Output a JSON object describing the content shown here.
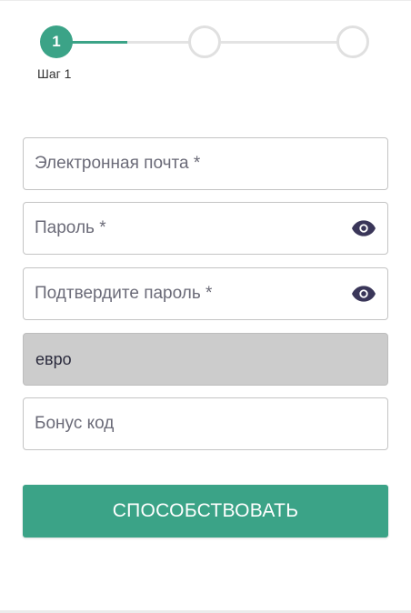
{
  "stepper": {
    "current_step_number": "1",
    "current_step_label": "Шаг 1",
    "total_steps": 3,
    "accent_color": "#3ba387"
  },
  "form": {
    "email": {
      "placeholder": "Электронная почта *",
      "value": ""
    },
    "password": {
      "placeholder": "Пароль *",
      "value": "",
      "toggle_icon": "eye-icon"
    },
    "confirm_password": {
      "placeholder": "Подтвердите пароль *",
      "value": "",
      "toggle_icon": "eye-icon"
    },
    "currency": {
      "selected": "евро"
    },
    "bonus_code": {
      "placeholder": "Бонус код",
      "value": ""
    },
    "submit_label": "СПОСОБСТВОВАТЬ"
  }
}
